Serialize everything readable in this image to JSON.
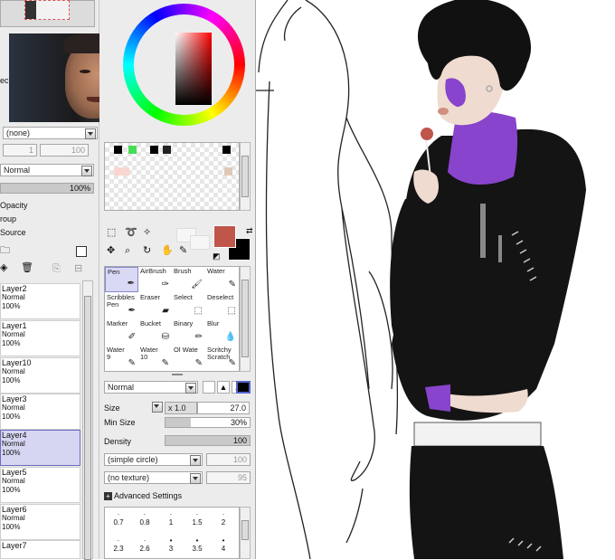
{
  "left_panel": {
    "blend_mode": "Normal",
    "opacity_value": "100%",
    "texture_select": "(none)",
    "num_field_1": "1",
    "num_field_2": "100",
    "opacity_label": "Opacity",
    "group_label": "roup",
    "source_label": "Source",
    "layers": [
      {
        "name": "Layer2",
        "mode": "Normal",
        "opacity": "100%"
      },
      {
        "name": "Layer1",
        "mode": "Normal",
        "opacity": "100%"
      },
      {
        "name": "Layer10",
        "mode": "Normal",
        "opacity": "100%"
      },
      {
        "name": "Layer3",
        "mode": "Normal",
        "opacity": "100%"
      },
      {
        "name": "Layer4",
        "mode": "Normal",
        "opacity": "100%"
      },
      {
        "name": "Layer5",
        "mode": "Normal",
        "opacity": "100%"
      },
      {
        "name": "Layer6",
        "mode": "Normal",
        "opacity": "100%"
      },
      {
        "name": "Layer7",
        "mode": "",
        "opacity": ""
      }
    ],
    "side_label": "ec"
  },
  "tools": {
    "items": [
      {
        "label": "Pen",
        "label2": "",
        "icon": "pen-icon"
      },
      {
        "label": "AirBrush",
        "label2": "",
        "icon": "airbrush-icon"
      },
      {
        "label": "Brush",
        "label2": "",
        "icon": "brush-icon"
      },
      {
        "label": "Water",
        "label2": "",
        "icon": "water-icon"
      },
      {
        "label": "Scribbles",
        "label2": "Pen",
        "icon": "scribble-icon"
      },
      {
        "label": "Eraser",
        "label2": "",
        "icon": "eraser-icon"
      },
      {
        "label": "Select",
        "label2": "",
        "icon": "select-icon"
      },
      {
        "label": "Deselect",
        "label2": "",
        "icon": "deselect-icon"
      },
      {
        "label": "Marker",
        "label2": "",
        "icon": "marker-icon"
      },
      {
        "label": "Bucket",
        "label2": "",
        "icon": "bucket-icon"
      },
      {
        "label": "Binary",
        "label2": "",
        "icon": "binary-icon"
      },
      {
        "label": "Blur",
        "label2": "",
        "icon": "blur-icon"
      },
      {
        "label": "Water",
        "label2": "9",
        "icon": "water-icon"
      },
      {
        "label": "Water",
        "label2": "10",
        "icon": "water-icon"
      },
      {
        "label": "Ol Wate",
        "label2": "",
        "icon": "oil-water-icon"
      },
      {
        "label": "Scritchy",
        "label2": "Scratch",
        "icon": "scratch-icon"
      }
    ]
  },
  "brush": {
    "blend_mode": "Normal",
    "size_label": "Size",
    "size_mult": "x 1.0",
    "size_value": "27.0",
    "min_size_label": "Min Size",
    "min_size_value": "30%",
    "min_size_fraction": 0.3,
    "density_label": "Density",
    "density_value": "100",
    "shape_select": "(simple circle)",
    "shape_value": "100",
    "texture_select": "(no texture)",
    "texture_value": "95",
    "advanced_label": "Advanced Settings",
    "sizes_row1": [
      "0.7",
      "0.8",
      "1",
      "1.5",
      "2"
    ],
    "sizes_row2": [
      "2.3",
      "2.6",
      "3",
      "3.5",
      "4"
    ]
  },
  "colors": {
    "foreground": "#c0554a",
    "background": "#000000",
    "swatches_top": [
      "#000000",
      "#44dd55",
      "#000000",
      "#000000",
      "#ffffff",
      "#000000"
    ],
    "swatches_second": [
      "#f9d6d0",
      "#f9d6d0",
      "#e0c8b8"
    ]
  },
  "canvas": {
    "hair_color": "#111111",
    "skin_color": "#f0dbd0",
    "scar_color": "#8844cc",
    "clothes_color": "#141414"
  }
}
